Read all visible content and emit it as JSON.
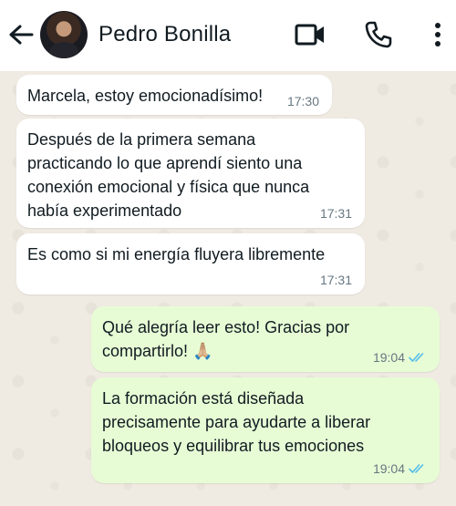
{
  "header": {
    "contact_name": "Pedro Bonilla"
  },
  "icons": {
    "back": "arrow-left-icon",
    "video": "video-camera-icon",
    "phone": "phone-icon",
    "more": "more-vertical-icon"
  },
  "colors": {
    "incoming_bubble": "#ffffff",
    "outgoing_bubble": "#e7fcd5",
    "chat_background": "#efeae2",
    "read_ticks": "#53bdeb"
  },
  "messages": [
    {
      "direction": "incoming",
      "lines": [
        "Marcela, estoy emocionadísimo!"
      ],
      "time": "17:30"
    },
    {
      "direction": "incoming",
      "lines": [
        "Después de la primera semana",
        "practicando lo que aprendí siento una",
        "conexión emocional y física que nunca",
        "había experimentado"
      ],
      "time": "17:31"
    },
    {
      "direction": "incoming",
      "lines": [
        "Es como si mi energía fluyera libremente"
      ],
      "time": "17:31"
    },
    {
      "direction": "outgoing",
      "lines": [
        "Qué alegría leer esto! Gracias por",
        "compartirlo! 🙏🏼"
      ],
      "time": "19:04",
      "status": "read"
    },
    {
      "direction": "outgoing",
      "lines": [
        "La formación está diseñada",
        "precisamente para ayudarte a liberar",
        "bloqueos y equilibrar tus emociones"
      ],
      "time": "19:04",
      "status": "read"
    }
  ]
}
